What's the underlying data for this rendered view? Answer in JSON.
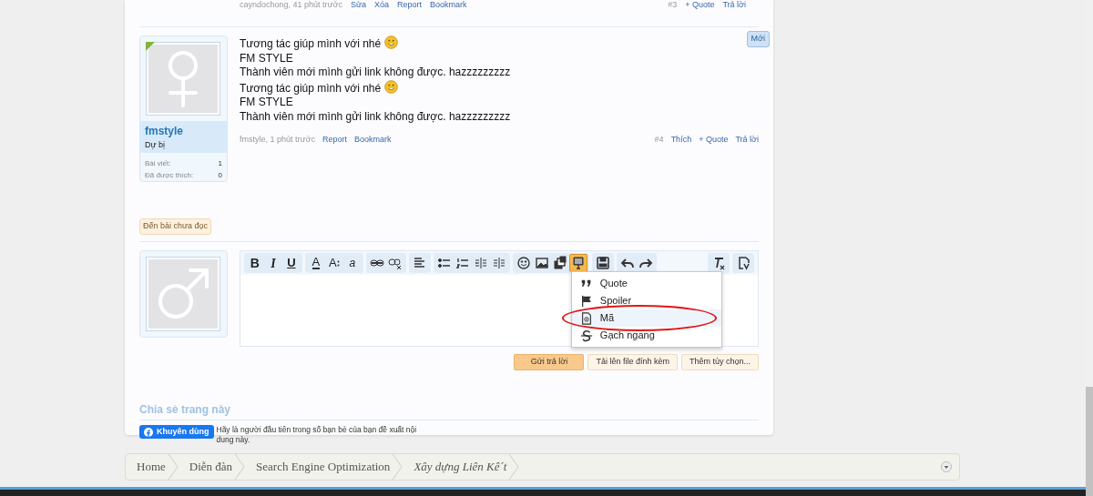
{
  "previous_post_footer": {
    "meta": "cayndochong, 41 phút trước",
    "links": [
      "Sửa",
      "Xóa",
      "Report",
      "Bookmark"
    ],
    "number": "#3",
    "actions": [
      "+ Quote",
      "Trả lời"
    ]
  },
  "post": {
    "new_badge": "Mới",
    "user": {
      "name": "fmstyle",
      "title": "Dự bị",
      "online": true,
      "avatar": {
        "kind": "female"
      },
      "stats": [
        {
          "label": "Bài viết:",
          "value": "1"
        },
        {
          "label": "Đã được thích:",
          "value": "0"
        }
      ]
    },
    "lines": [
      {
        "text": "Tương tác giúp mình với nhé",
        "emoticon": true
      },
      {
        "text": "FM STYLE",
        "emoticon": false
      },
      {
        "text": "Thành viên mới mình gửi link không được. hazzzzzzzzz",
        "emoticon": false
      },
      {
        "text": "Tương tác giúp mình với nhé",
        "emoticon": true
      },
      {
        "text": "FM STYLE",
        "emoticon": false
      },
      {
        "text": "Thành viên mới mình gửi link không được. hazzzzzzzzz",
        "emoticon": false
      }
    ],
    "meta": "fmstyle, 1 phút trước",
    "links": [
      "Report",
      "Bookmark"
    ],
    "number": "#4",
    "actions": [
      "Thích",
      "+ Quote",
      "Trả lời"
    ]
  },
  "unread_link": "Đến bài chưa đọc",
  "reply": {
    "avatar": {
      "kind": "male"
    },
    "toolbar_left": [
      [
        {
          "kind": "bold",
          "label": "B",
          "selected": false
        },
        {
          "kind": "italic",
          "label": "I",
          "selected": false
        },
        {
          "kind": "underline",
          "label": "U",
          "selected": false
        }
      ],
      [
        {
          "kind": "text-color",
          "label": "A",
          "selected": false
        },
        {
          "kind": "font-size",
          "label": "A",
          "selected": false
        },
        {
          "kind": "font-family",
          "label": "a",
          "selected": false
        }
      ],
      [
        {
          "kind": "link",
          "selected": false
        },
        {
          "kind": "unlink",
          "selected": false
        }
      ],
      [
        {
          "kind": "align",
          "selected": false
        }
      ],
      [
        {
          "kind": "bullet-list",
          "selected": false
        },
        {
          "kind": "number-list",
          "selected": false
        },
        {
          "kind": "outdent",
          "selected": false
        },
        {
          "kind": "indent",
          "selected": false
        }
      ],
      [
        {
          "kind": "smiley",
          "selected": false
        },
        {
          "kind": "image",
          "selected": false
        },
        {
          "kind": "media",
          "selected": false
        },
        {
          "kind": "insert",
          "selected": true
        }
      ],
      [
        {
          "kind": "save",
          "selected": false
        }
      ],
      [
        {
          "kind": "undo",
          "selected": false
        },
        {
          "kind": "redo",
          "selected": false
        }
      ]
    ],
    "toolbar_right": [
      [
        {
          "kind": "clear-format",
          "selected": false
        }
      ],
      [
        {
          "kind": "toggle-source",
          "selected": false
        }
      ]
    ],
    "insert_menu": [
      {
        "kind": "quote",
        "label": "Quote",
        "selected": false,
        "circled": false
      },
      {
        "kind": "spoiler",
        "label": "Spoiler",
        "selected": false,
        "circled": false
      },
      {
        "kind": "code",
        "label": "Mã",
        "selected": true,
        "circled": true
      },
      {
        "kind": "strike",
        "label": "Gạch ngang",
        "selected": false,
        "circled": false
      }
    ],
    "buttons": [
      {
        "label": "Gửi trả lời",
        "primary": true
      },
      {
        "label": "Tải lên file đính kèm",
        "primary": false
      },
      {
        "label": "Thêm tùy chọn...",
        "primary": false
      }
    ]
  },
  "share": {
    "title": "Chia sẻ trang này",
    "like_button": "Khuyên dùng",
    "like_text": "Hãy là người đầu tiên trong số bạn bè của bạn đề xuất nội dung này."
  },
  "breadcrumb": [
    {
      "label": "Home",
      "current": false
    },
    {
      "label": "Diễn đàn",
      "current": false
    },
    {
      "label": "Search Engine Optimization",
      "current": false
    },
    {
      "label": "Xây dựng Liên Kê´t",
      "current": true
    }
  ]
}
